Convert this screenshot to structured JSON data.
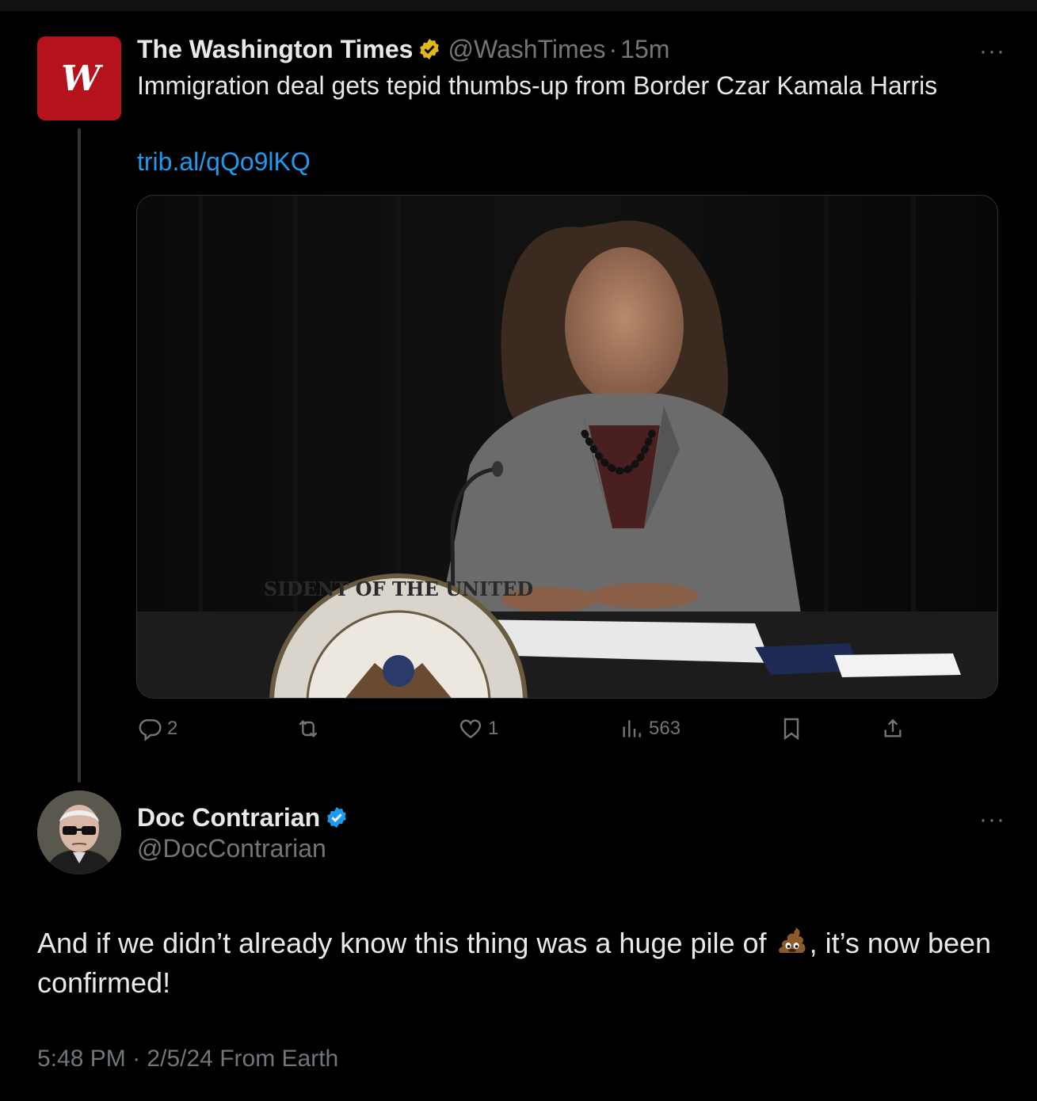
{
  "parent_tweet": {
    "author_name": "The Washington Times",
    "avatar_letter": "W",
    "handle": "@WashTimes",
    "separator": "·",
    "time_ago": "15m",
    "more": "···",
    "text": "Immigration deal gets tepid thumbs-up from Border Czar Kamala Harris",
    "link": "trib.al/qQo9lKQ",
    "photo_seal_text": "SIDENT OF THE UNITED",
    "actions": {
      "replies": "2",
      "reposts": "",
      "likes": "1",
      "views": "563"
    }
  },
  "reply_tweet": {
    "author_name": "Doc Contrarian",
    "handle": "@DocContrarian",
    "more": "···",
    "text_before_emoji": "And if we didn’t already know this thing was a huge pile of",
    "emoji": "pile-of-poo",
    "text_after_emoji": ", it’s now been confirmed!",
    "time": "5:48 PM",
    "separator": "·",
    "date": "2/5/24",
    "source": "From Earth"
  },
  "colors": {
    "background": "#000000",
    "text_primary": "#e7e9ea",
    "text_secondary": "#71767b",
    "link": "#1d9bf0",
    "gold_badge": "#e2b719",
    "blue_badge": "#1d9bf0",
    "wt_brand": "#b5121b"
  }
}
